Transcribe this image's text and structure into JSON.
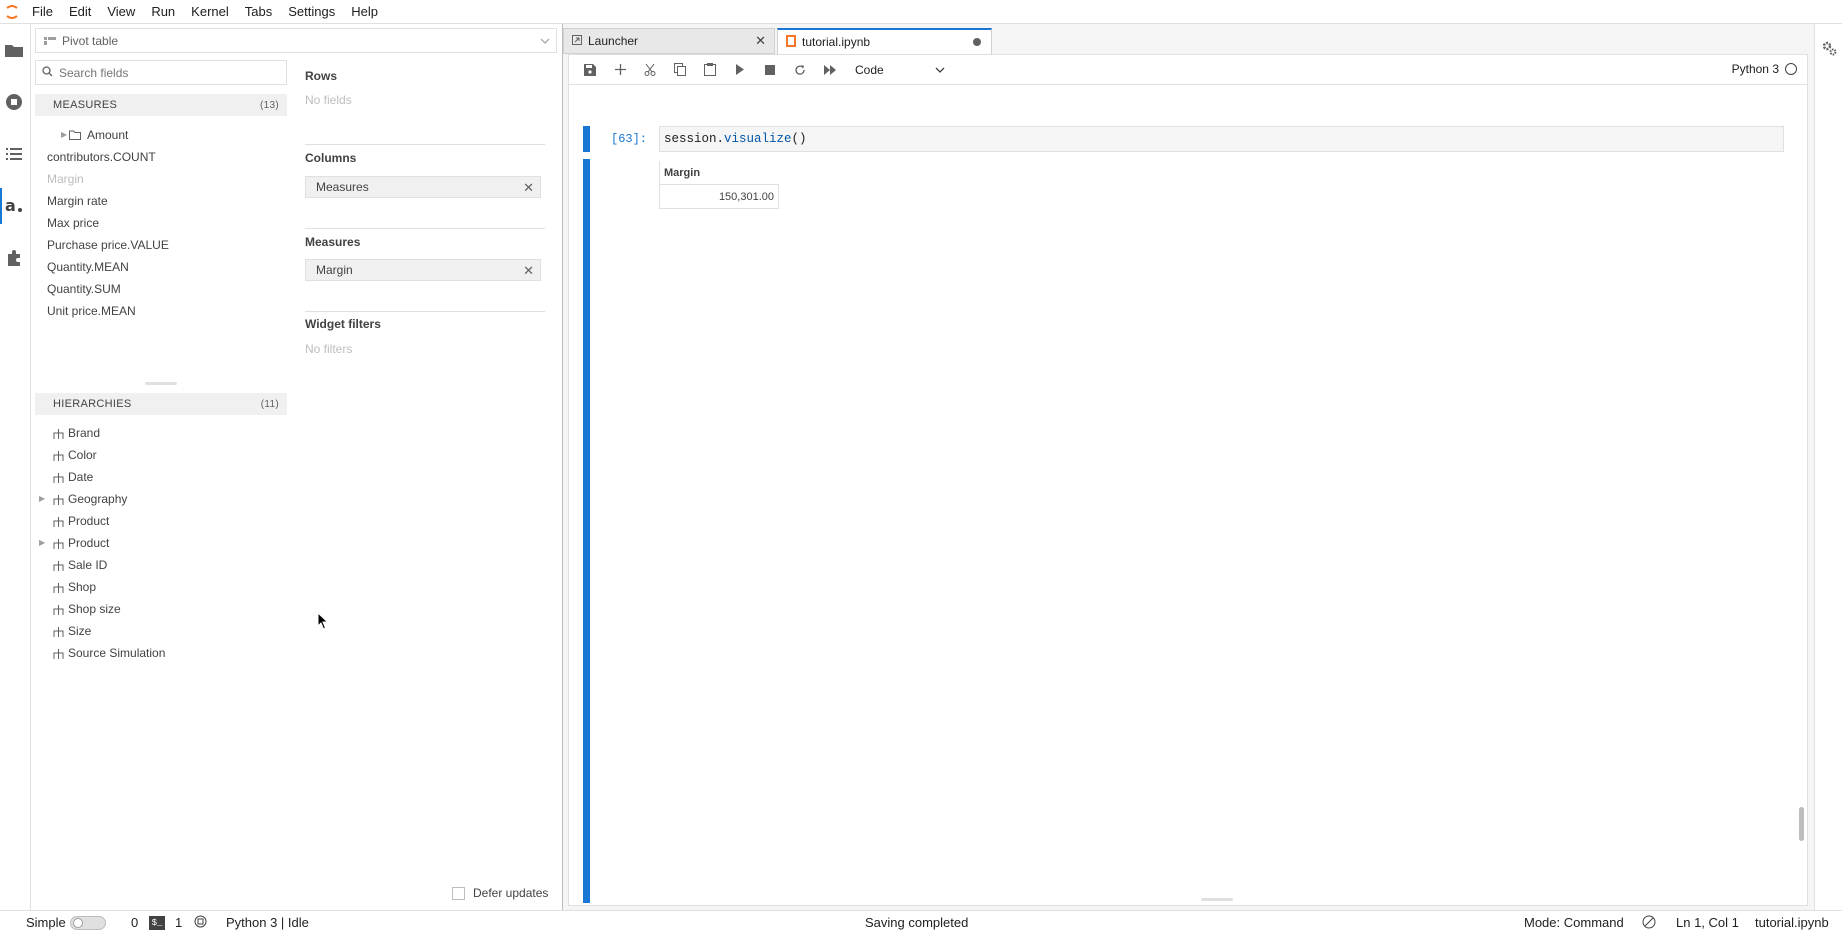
{
  "menu": [
    "File",
    "Edit",
    "View",
    "Run",
    "Kernel",
    "Tabs",
    "Settings",
    "Help"
  ],
  "side": {
    "widget": "Pivot table",
    "search_placeholder": "Search fields",
    "measures_header": "MEASURES",
    "measures_count": "(13)",
    "measures": [
      {
        "label": "Amount",
        "folder": true
      },
      {
        "label": "contributors.COUNT"
      },
      {
        "label": "Margin",
        "disabled": true
      },
      {
        "label": "Margin rate"
      },
      {
        "label": "Max price"
      },
      {
        "label": "Purchase price.VALUE"
      },
      {
        "label": "Quantity.MEAN"
      },
      {
        "label": "Quantity.SUM"
      },
      {
        "label": "Unit price.MEAN"
      }
    ],
    "hierarchies_header": "HIERARCHIES",
    "hierarchies_count": "(11)",
    "hierarchies": [
      {
        "label": "Brand"
      },
      {
        "label": "Color"
      },
      {
        "label": "Date"
      },
      {
        "label": "Geography",
        "expandable": true
      },
      {
        "label": "Product"
      },
      {
        "label": "Product",
        "expandable": true
      },
      {
        "label": "Sale ID"
      },
      {
        "label": "Shop"
      },
      {
        "label": "Shop size"
      },
      {
        "label": "Size"
      },
      {
        "label": "Source Simulation"
      }
    ],
    "rows_title": "Rows",
    "rows_empty": "No fields",
    "columns_title": "Columns",
    "columns_chip": "Measures",
    "measures_title": "Measures",
    "measures_chip": "Margin",
    "filters_title": "Widget filters",
    "filters_empty": "No filters",
    "defer_label": "Defer updates"
  },
  "tabs": {
    "launcher": "Launcher",
    "notebook": "tutorial.ipynb"
  },
  "toolbar": {
    "cell_type": "Code",
    "kernel": "Python 3"
  },
  "cell": {
    "prompt": "[63]:",
    "code_obj": "session.",
    "code_fn": "visualize",
    "code_end": "()",
    "output_header": "Margin",
    "output_value": "150,301.00"
  },
  "status": {
    "mode_label": "Simple",
    "terminals": "0",
    "kernels": "1",
    "kernel_status": "Python 3 | Idle",
    "save_status": "Saving completed",
    "mode": "Mode: Command",
    "position": "Ln 1, Col 1",
    "file": "tutorial.ipynb"
  }
}
